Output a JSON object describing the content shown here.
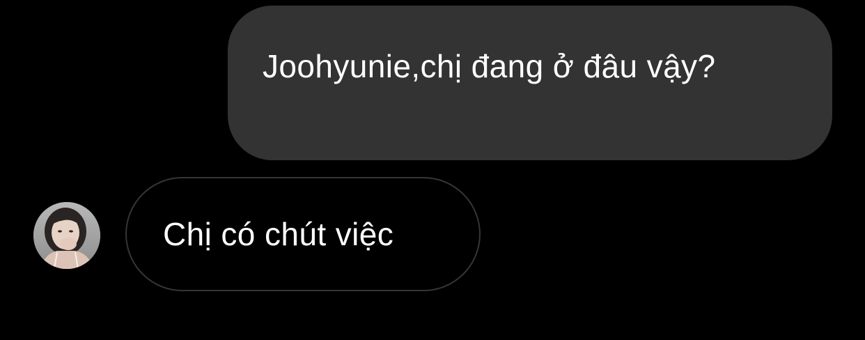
{
  "theme": {
    "background": "#000000",
    "sent_bubble": "#333333",
    "received_border": "#363636",
    "text": "#ffffff"
  },
  "messages": [
    {
      "direction": "outgoing",
      "text": "Joohyunie,chị đang ở đâu vậy?"
    },
    {
      "direction": "incoming",
      "avatar": "contact-avatar-photo",
      "text": "Chị có chút việc"
    }
  ]
}
